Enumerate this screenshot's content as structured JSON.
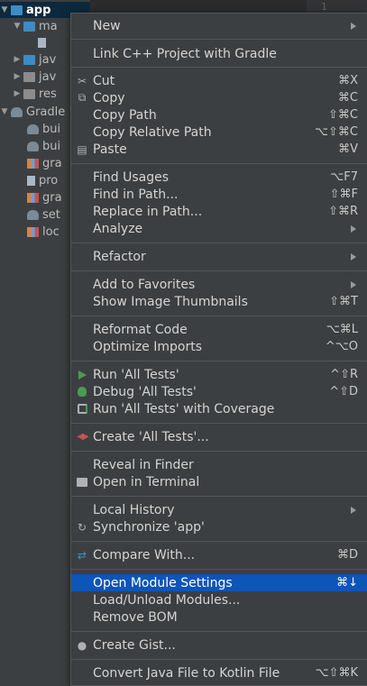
{
  "tree": {
    "items": [
      {
        "label": "app",
        "arrow": "▼",
        "icon": "module-folder-icon"
      },
      {
        "label": "ma",
        "arrow": "▼",
        "icon": "folder-icon"
      },
      {
        "label": "",
        "arrow": "",
        "icon": "manifest-file-icon"
      },
      {
        "label": "jav",
        "arrow": "▶",
        "icon": "folder-icon"
      },
      {
        "label": "jav",
        "arrow": "▶",
        "icon": "folder-icon"
      },
      {
        "label": "res",
        "arrow": "▶",
        "icon": "folder-icon"
      },
      {
        "label": "Gradle",
        "arrow": "▼",
        "icon": "gradle-icon"
      },
      {
        "label": "bui",
        "arrow": "",
        "icon": "gradle-icon"
      },
      {
        "label": "bui",
        "arrow": "",
        "icon": "gradle-icon"
      },
      {
        "label": "gra",
        "arrow": "",
        "icon": "properties-icon"
      },
      {
        "label": "pro",
        "arrow": "",
        "icon": "file-icon"
      },
      {
        "label": "gra",
        "arrow": "",
        "icon": "properties-icon"
      },
      {
        "label": "set",
        "arrow": "",
        "icon": "gradle-icon"
      },
      {
        "label": "loc",
        "arrow": "",
        "icon": "properties-icon"
      }
    ]
  },
  "editor": {
    "line_number": "1"
  },
  "menu": {
    "items": [
      {
        "label": "New",
        "shortcut": "",
        "submenu": true,
        "icon": ""
      },
      {
        "label": "Link C++ Project with Gradle",
        "shortcut": "",
        "submenu": false,
        "icon": ""
      },
      {
        "label": "Cut",
        "shortcut": "⌘X",
        "submenu": false,
        "icon": "scissors-icon"
      },
      {
        "label": "Copy",
        "shortcut": "⌘C",
        "submenu": false,
        "icon": "copy-icon"
      },
      {
        "label": "Copy Path",
        "shortcut": "⇧⌘C",
        "submenu": false,
        "icon": ""
      },
      {
        "label": "Copy Relative Path",
        "shortcut": "⌥⇧⌘C",
        "submenu": false,
        "icon": ""
      },
      {
        "label": "Paste",
        "shortcut": "⌘V",
        "submenu": false,
        "icon": "paste-icon"
      },
      {
        "label": "Find Usages",
        "shortcut": "⌥F7",
        "submenu": false,
        "icon": ""
      },
      {
        "label": "Find in Path...",
        "shortcut": "⇧⌘F",
        "submenu": false,
        "icon": ""
      },
      {
        "label": "Replace in Path...",
        "shortcut": "⇧⌘R",
        "submenu": false,
        "icon": ""
      },
      {
        "label": "Analyze",
        "shortcut": "",
        "submenu": true,
        "icon": ""
      },
      {
        "label": "Refactor",
        "shortcut": "",
        "submenu": true,
        "icon": ""
      },
      {
        "label": "Add to Favorites",
        "shortcut": "",
        "submenu": true,
        "icon": ""
      },
      {
        "label": "Show Image Thumbnails",
        "shortcut": "⇧⌘T",
        "submenu": false,
        "icon": ""
      },
      {
        "label": "Reformat Code",
        "shortcut": "⌥⌘L",
        "submenu": false,
        "icon": ""
      },
      {
        "label": "Optimize Imports",
        "shortcut": "^⌥O",
        "submenu": false,
        "icon": ""
      },
      {
        "label": "Run 'All Tests'",
        "shortcut": "^⇧R",
        "submenu": false,
        "icon": "run-icon"
      },
      {
        "label": "Debug 'All Tests'",
        "shortcut": "^⇧D",
        "submenu": false,
        "icon": "debug-icon"
      },
      {
        "label": "Run 'All Tests' with Coverage",
        "shortcut": "",
        "submenu": false,
        "icon": "coverage-icon"
      },
      {
        "label": "Create 'All Tests'...",
        "shortcut": "",
        "submenu": false,
        "icon": "create-test-icon"
      },
      {
        "label": "Reveal in Finder",
        "shortcut": "",
        "submenu": false,
        "icon": ""
      },
      {
        "label": "Open in Terminal",
        "shortcut": "",
        "submenu": false,
        "icon": "terminal-icon"
      },
      {
        "label": "Local History",
        "shortcut": "",
        "submenu": true,
        "icon": ""
      },
      {
        "label": "Synchronize 'app'",
        "shortcut": "",
        "submenu": false,
        "icon": "sync-icon"
      },
      {
        "label": "Compare With...",
        "shortcut": "⌘D",
        "submenu": false,
        "icon": "compare-icon"
      },
      {
        "label": "Open Module Settings",
        "shortcut": "⌘↓",
        "submenu": false,
        "icon": "",
        "highlighted": true
      },
      {
        "label": "Load/Unload Modules...",
        "shortcut": "",
        "submenu": false,
        "icon": ""
      },
      {
        "label": "Remove BOM",
        "shortcut": "",
        "submenu": false,
        "icon": ""
      },
      {
        "label": "Create Gist...",
        "shortcut": "",
        "submenu": false,
        "icon": "github-icon"
      },
      {
        "label": "Convert Java File to Kotlin File",
        "shortcut": "⌥⇧⌘K",
        "submenu": false,
        "icon": ""
      }
    ]
  },
  "colors": {
    "highlight": "#0d55b8",
    "menu_bg": "#3c3f41",
    "run_green": "#499c54"
  }
}
